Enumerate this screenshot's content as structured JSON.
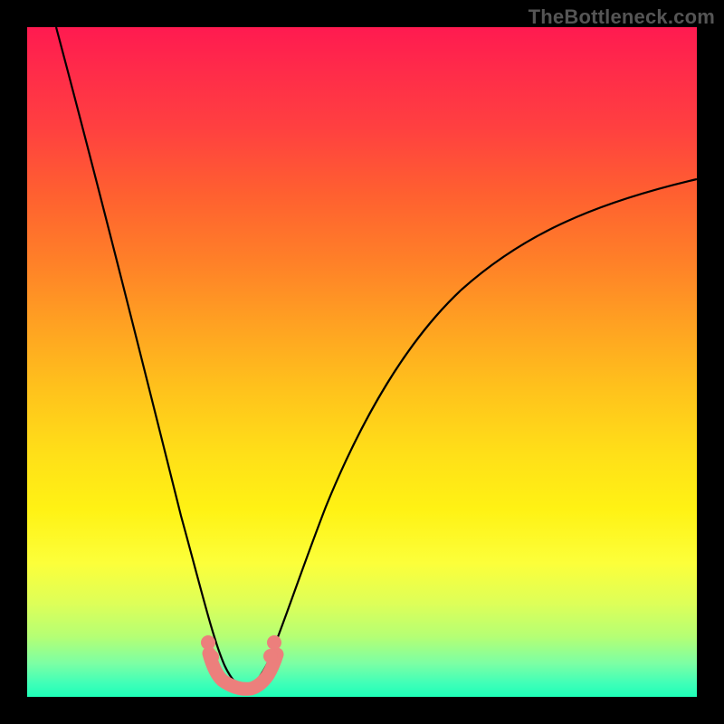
{
  "watermark": "TheBottleneck.com",
  "colors": {
    "background": "#000000",
    "curve": "#000000",
    "marker": "#ec7f7c",
    "gradient_top": "#ff1a50",
    "gradient_bottom": "#1effb8"
  },
  "chart_data": {
    "type": "line",
    "title": "",
    "xlabel": "",
    "ylabel": "",
    "xlim": [
      0,
      100
    ],
    "ylim": [
      0,
      100
    ],
    "x": [
      3,
      6,
      9,
      12,
      15,
      18,
      21,
      24,
      26,
      28,
      30,
      31,
      32,
      33,
      35,
      38,
      42,
      46,
      52,
      58,
      66,
      74,
      82,
      90,
      100
    ],
    "values": [
      100,
      90,
      80,
      70,
      60,
      50,
      40,
      28,
      18,
      10,
      4,
      2,
      1.5,
      2,
      4,
      12,
      24,
      34,
      46,
      55,
      63,
      68,
      72,
      75,
      78
    ],
    "series": [
      {
        "name": "bottleneck-curve",
        "x": [
          3,
          6,
          9,
          12,
          15,
          18,
          21,
          24,
          26,
          28,
          30,
          31,
          32,
          33,
          35,
          38,
          42,
          46,
          52,
          58,
          66,
          74,
          82,
          90,
          100
        ],
        "values": [
          100,
          90,
          80,
          70,
          60,
          50,
          40,
          28,
          18,
          10,
          4,
          2,
          1.5,
          2,
          4,
          12,
          24,
          34,
          46,
          55,
          63,
          68,
          72,
          75,
          78
        ]
      }
    ],
    "annotations": [
      {
        "name": "optimal-range-marker",
        "x_range": [
          26,
          35
        ],
        "y_approx": 3
      }
    ]
  }
}
